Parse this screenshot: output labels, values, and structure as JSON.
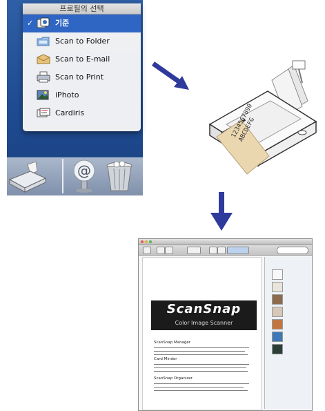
{
  "menu": {
    "title": "프로필의 선택",
    "items": [
      {
        "label": "기준",
        "icon": "standard-profile-icon",
        "selected": true
      },
      {
        "label": "Scan to Folder",
        "icon": "folder-icon",
        "selected": false
      },
      {
        "label": "Scan to E-mail",
        "icon": "mail-icon",
        "selected": false
      },
      {
        "label": "Scan to Print",
        "icon": "printer-icon",
        "selected": false
      },
      {
        "label": "iPhoto",
        "icon": "iphoto-icon",
        "selected": false
      },
      {
        "label": "Cardiris",
        "icon": "cardiris-icon",
        "selected": false
      }
    ],
    "check_mark": "✓"
  },
  "dock": {
    "icons": [
      "scanner-icon",
      "mail-at-icon",
      "trash-icon"
    ],
    "at_symbol": "@"
  },
  "scanner_paper": {
    "line1": "1234567890",
    "line2": "ABCDEFG"
  },
  "document": {
    "banner_title": "ScanSnap",
    "banner_subtitle": "Color Image Scanner",
    "sections": [
      "ScanSnap Manager",
      "Card Minder",
      "ScanSnap Organizer"
    ]
  },
  "colors": {
    "arrow": "#2e3a9c",
    "selection": "#2f66c4",
    "dock_blue": "#2f5fa6"
  }
}
